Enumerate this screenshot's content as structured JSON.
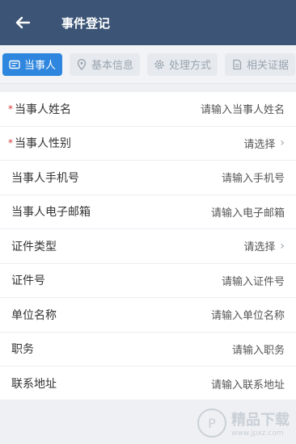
{
  "header": {
    "title": "事件登记",
    "back_icon": "arrow-left-icon"
  },
  "tabs": [
    {
      "label": "当事人",
      "icon": "id-card-icon",
      "active": true
    },
    {
      "label": "基本信息",
      "icon": "location-pin-icon",
      "active": false
    },
    {
      "label": "处理方式",
      "icon": "gear-icon",
      "active": false
    },
    {
      "label": "相关证据",
      "icon": "document-icon",
      "active": false
    }
  ],
  "form": {
    "rows": [
      {
        "label": "当事人姓名",
        "placeholder": "请输入当事人姓名",
        "required": "*"
      },
      {
        "label": "当事人性别",
        "placeholder": "请选择",
        "required": "*",
        "chevron": "›"
      },
      {
        "label": "当事人手机号",
        "placeholder": "请输入手机号"
      },
      {
        "label": "当事人电子邮箱",
        "placeholder": "请输入电子邮箱"
      },
      {
        "label": "证件类型",
        "placeholder": "请选择",
        "chevron": "›"
      },
      {
        "label": "证件号",
        "placeholder": "请输入证件号"
      },
      {
        "label": "单位名称",
        "placeholder": "请输入单位名称"
      },
      {
        "label": "职务",
        "placeholder": "请输入职务"
      },
      {
        "label": "联系地址",
        "placeholder": "请输入联系地址"
      }
    ]
  },
  "watermark": {
    "text": "精品下载",
    "url": "www.jpxz.com"
  },
  "colors": {
    "header_bg": "#3c5476",
    "accent": "#2e86de",
    "required": "#d63b3b"
  }
}
